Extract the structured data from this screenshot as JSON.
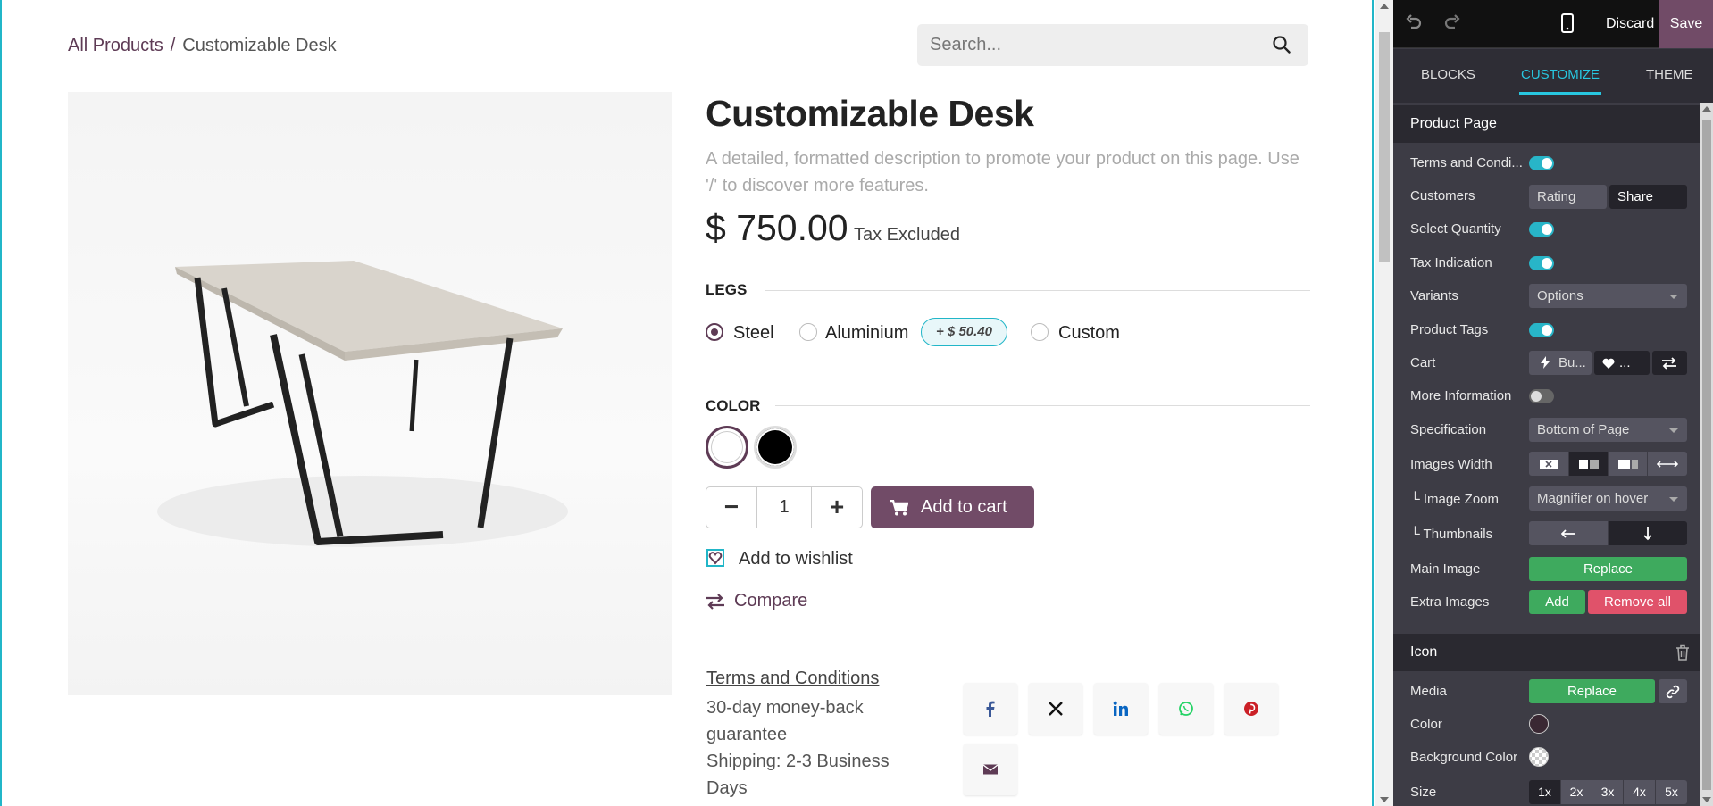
{
  "breadcrumb": {
    "parent": "All Products",
    "separator": "/",
    "current": "Customizable Desk"
  },
  "search": {
    "placeholder": "Search..."
  },
  "product": {
    "title": "Customizable Desk",
    "description": "A detailed, formatted description to promote your product on this page. Use '/' to discover more features.",
    "price": "$ 750.00",
    "tax_note": "Tax Excluded"
  },
  "legs": {
    "heading": "LEGS",
    "options": [
      {
        "label": "Steel",
        "selected": true
      },
      {
        "label": "Aluminium",
        "selected": false,
        "extra_prefix": "+",
        "extra": "$ 50.40"
      },
      {
        "label": "Custom",
        "selected": false
      }
    ]
  },
  "color": {
    "heading": "COLOR",
    "swatches": [
      {
        "name": "White",
        "hex": "#ffffff",
        "selected": true
      },
      {
        "name": "Black",
        "hex": "#000000",
        "selected": false
      }
    ]
  },
  "cart": {
    "quantity": "1",
    "minus": "−",
    "plus": "+",
    "add_label": "Add to cart"
  },
  "wishlist_label": "Add to wishlist",
  "compare_label": "Compare",
  "terms": {
    "link": "Terms and Conditions",
    "line1": "30-day money-back guarantee",
    "line2": "Shipping: 2-3 Business Days"
  },
  "share_icons": [
    "facebook-icon",
    "x-twitter-icon",
    "linkedin-icon",
    "whatsapp-icon",
    "pinterest-icon",
    "email-icon"
  ],
  "colors": {
    "brand": "#714b67",
    "accent": "#21b6c8",
    "toggle_on": "#28b5c8",
    "green": "#3eaa5e",
    "red": "#e0526a"
  },
  "editor": {
    "discard": "Discard",
    "save": "Save",
    "tabs": [
      "BLOCKS",
      "CUSTOMIZE",
      "THEME"
    ],
    "active_tab": "CUSTOMIZE",
    "product_page": {
      "title": "Product Page",
      "terms": "Terms and Condi...",
      "customers": "Customers",
      "rating": "Rating",
      "share": "Share",
      "select_quantity": "Select Quantity",
      "tax_indication": "Tax Indication",
      "variants": "Variants",
      "variants_value": "Options",
      "product_tags": "Product Tags",
      "cart": "Cart",
      "cart_buy": "Bu...",
      "cart_wish": "...",
      "more_information": "More Information",
      "specification": "Specification",
      "specification_value": "Bottom of Page",
      "images_width": "Images Width",
      "image_zoom_prefix": "└",
      "image_zoom": "Image Zoom",
      "image_zoom_value": "Magnifier on hover",
      "thumbnails": "Thumbnails",
      "main_image": "Main Image",
      "replace": "Replace",
      "extra_images": "Extra Images",
      "add": "Add",
      "remove_all": "Remove all"
    },
    "icon_section": {
      "title": "Icon",
      "media": "Media",
      "replace": "Replace",
      "color": "Color",
      "color_value": "#3a2833",
      "background_color": "Background Color",
      "size": "Size",
      "sizes": [
        "1x",
        "2x",
        "3x",
        "4x",
        "5x"
      ],
      "active_size": "1x"
    }
  }
}
